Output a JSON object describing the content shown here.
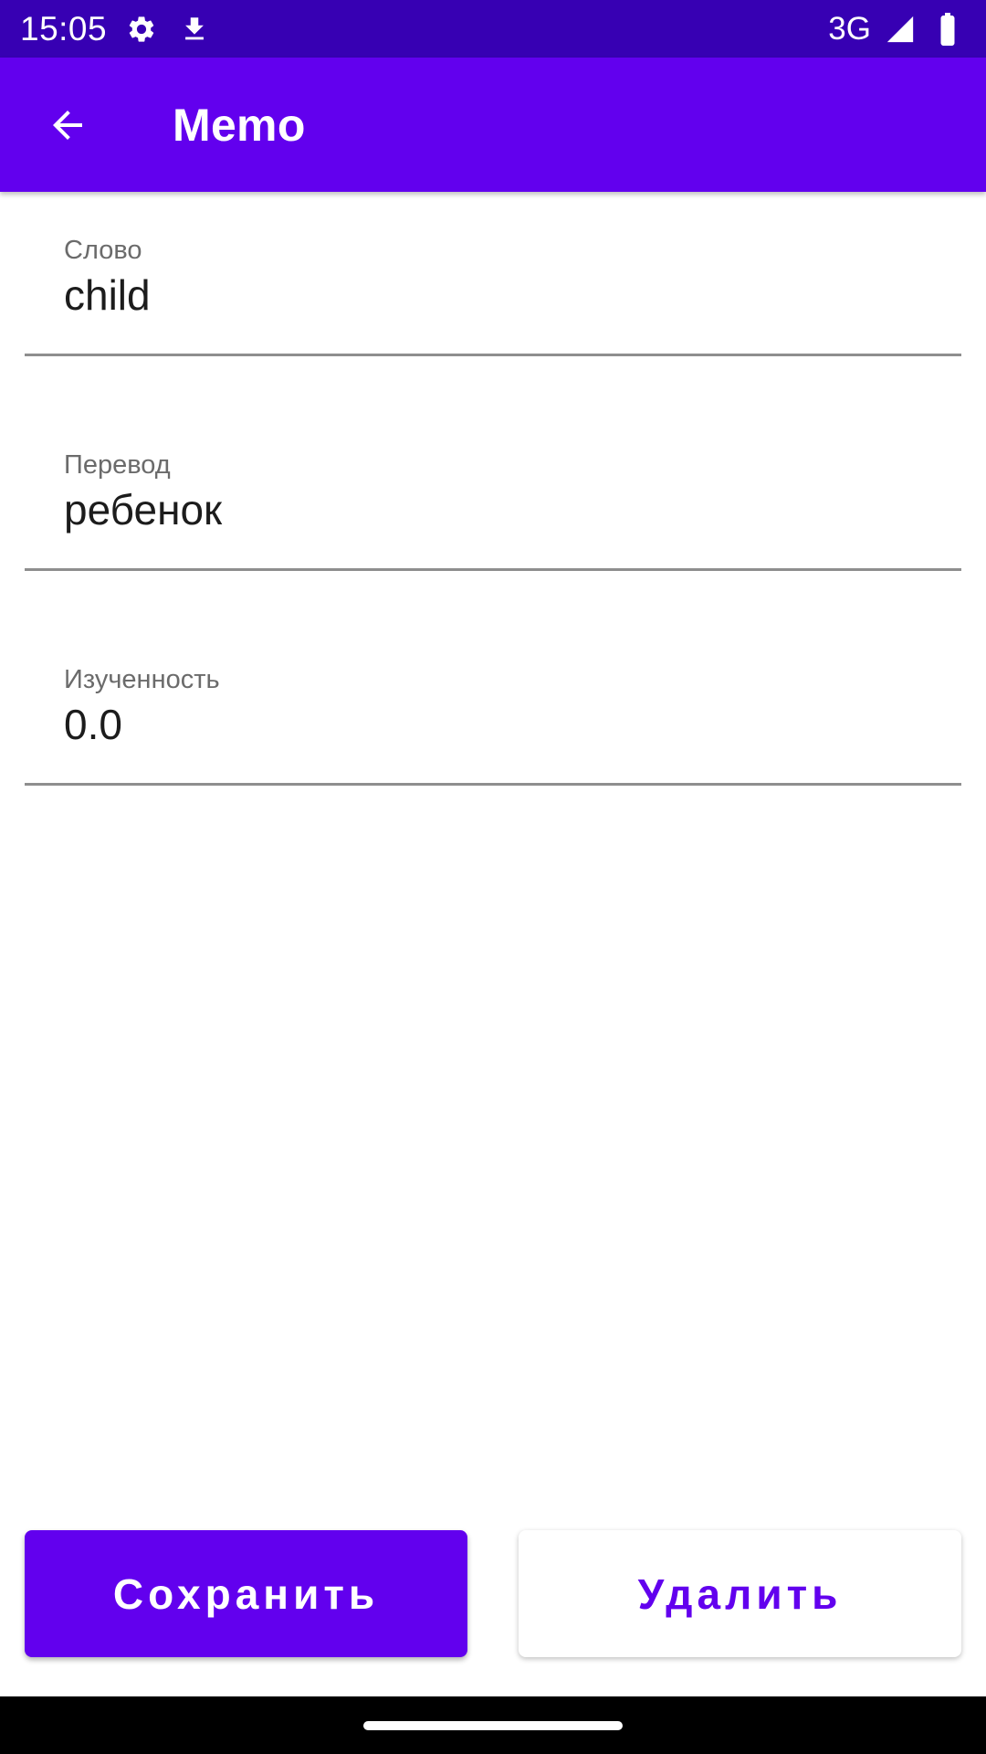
{
  "status_bar": {
    "time": "15:05",
    "network": "3G",
    "icons": [
      "settings-icon",
      "download-icon",
      "signal-icon",
      "battery-icon"
    ]
  },
  "app_bar": {
    "title": "Memo",
    "back_icon": "arrow-back-icon"
  },
  "form": {
    "word": {
      "label": "Слово",
      "value": "child"
    },
    "translation": {
      "label": "Перевод",
      "value": "ребенок"
    },
    "progress": {
      "label": "Изученность",
      "value": "0.0"
    }
  },
  "actions": {
    "save_label": "Сохранить",
    "delete_label": "Удалить"
  },
  "colors": {
    "primary": "#6200ee",
    "primary_dark": "#3700b3",
    "divider": "#8e8e8e"
  }
}
